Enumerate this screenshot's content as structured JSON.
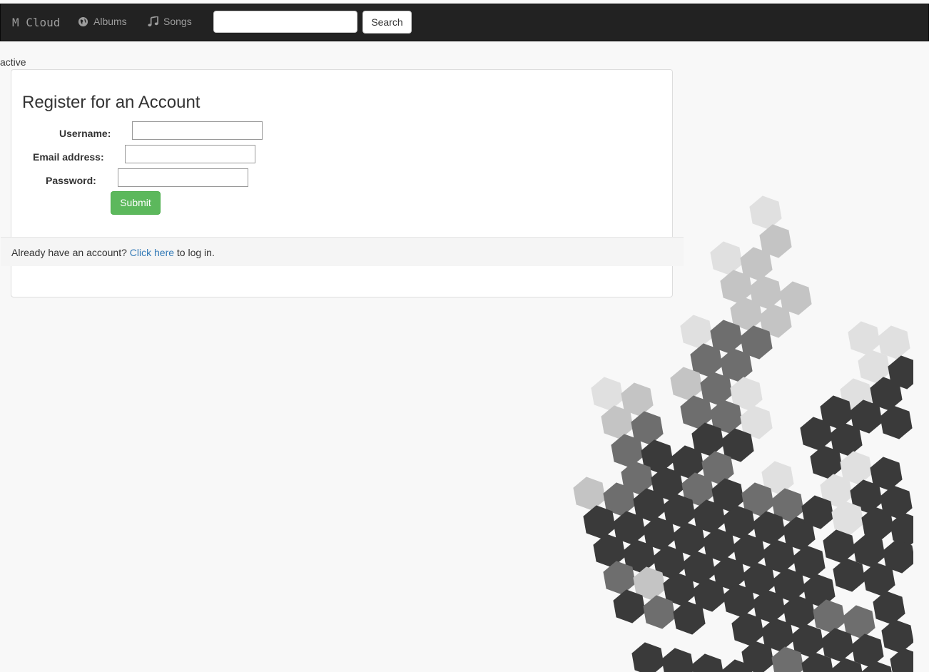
{
  "navbar": {
    "brand": "M Cloud",
    "links": [
      {
        "label": "Albums",
        "icon": "globe-icon"
      },
      {
        "label": "Songs",
        "icon": "music-note-icon"
      }
    ],
    "search": {
      "value": "",
      "placeholder": "",
      "button_label": "Search"
    }
  },
  "status_text": "active",
  "register": {
    "title": "Register for an Account",
    "fields": [
      {
        "label": "Username:",
        "value": ""
      },
      {
        "label": "Email address:",
        "value": ""
      },
      {
        "label": "Password:",
        "value": ""
      }
    ],
    "submit_label": "Submit"
  },
  "footer": {
    "prefix": "Already have an account?",
    "link_text": "Click here",
    "suffix": "to log in."
  },
  "colors": {
    "navbar_bg": "#222222",
    "submit_green": "#5cb85c",
    "link_blue": "#337ab7",
    "hex_dark": "#3a3a3a",
    "hex_mid": "#6e6e6e",
    "hex_light": "#c4c4c4",
    "hex_pale": "#e0e0e0"
  }
}
